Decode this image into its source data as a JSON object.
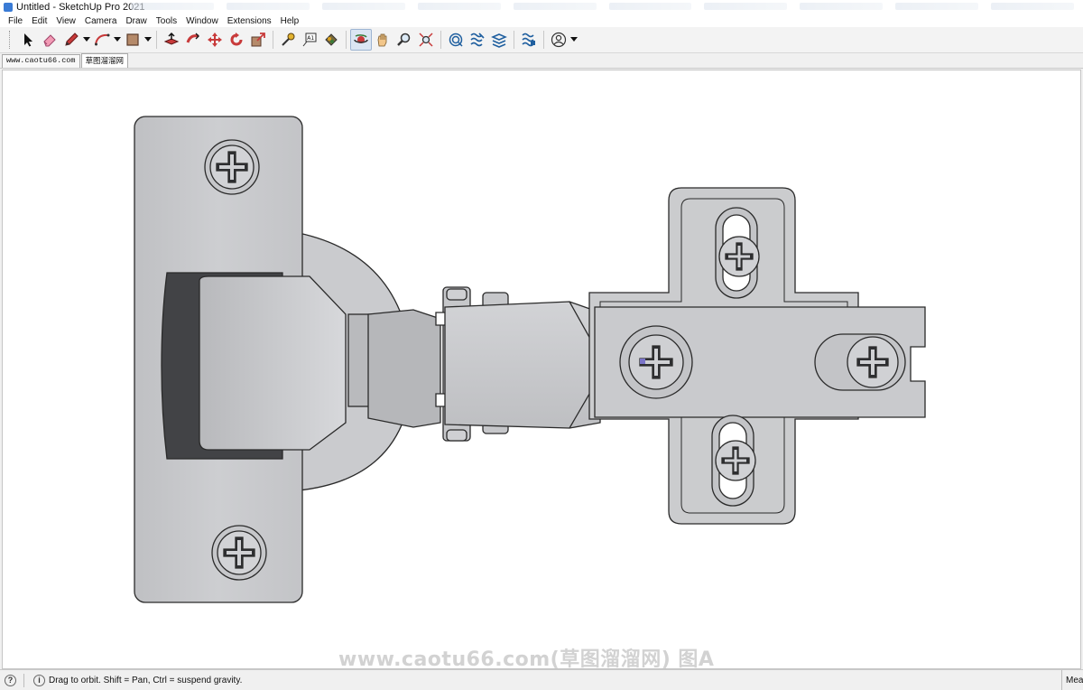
{
  "window": {
    "title": "Untitled - SketchUp Pro 2021"
  },
  "menu": [
    "File",
    "Edit",
    "View",
    "Camera",
    "Draw",
    "Tools",
    "Window",
    "Extensions",
    "Help"
  ],
  "toolbar": {
    "tools": [
      {
        "name": "select-tool",
        "icon": "arrow-icon"
      },
      {
        "name": "eraser-tool",
        "icon": "eraser-icon"
      },
      {
        "name": "pencil-tool",
        "icon": "pencil-icon"
      },
      {
        "name": "arc-tool",
        "icon": "arc-icon"
      },
      {
        "name": "rectangle-tool",
        "icon": "rectangle-icon"
      },
      {
        "name": "push-pull-tool",
        "icon": "push-pull-icon"
      },
      {
        "name": "follow-me-tool",
        "icon": "follow-me-icon"
      },
      {
        "name": "move-tool",
        "icon": "move-icon"
      },
      {
        "name": "rotate-tool",
        "icon": "rotate-icon"
      },
      {
        "name": "scale-tool",
        "icon": "scale-icon"
      },
      {
        "name": "tape-measure-tool",
        "icon": "tape-measure-icon"
      },
      {
        "name": "text-tool",
        "icon": "text-icon"
      },
      {
        "name": "paint-bucket-tool",
        "icon": "paint-bucket-icon"
      },
      {
        "name": "orbit-tool",
        "icon": "orbit-icon"
      },
      {
        "name": "pan-tool",
        "icon": "pan-icon"
      },
      {
        "name": "zoom-tool",
        "icon": "zoom-icon"
      },
      {
        "name": "zoom-extents-tool",
        "icon": "zoom-extents-icon"
      },
      {
        "name": "warehouse-tool",
        "icon": "warehouse-icon"
      },
      {
        "name": "extension-warehouse-tool",
        "icon": "extension-warehouse-icon"
      },
      {
        "name": "layout-tool",
        "icon": "layout-icon"
      },
      {
        "name": "extension-manager-tool",
        "icon": "extension-manager-icon"
      },
      {
        "name": "account-tool",
        "icon": "account-icon"
      }
    ]
  },
  "scenes": [
    "www.caotu66.com",
    "草图溜溜网"
  ],
  "viewport": {
    "watermark": "www.caotu66.com(草图溜溜网) 图A"
  },
  "status": {
    "message": "Drag to orbit. Shift = Pan, Ctrl = suspend gravity.",
    "right_label": "Measurements"
  },
  "colors": {
    "accent": "#3a7bd5",
    "model": "#c9cacd"
  }
}
